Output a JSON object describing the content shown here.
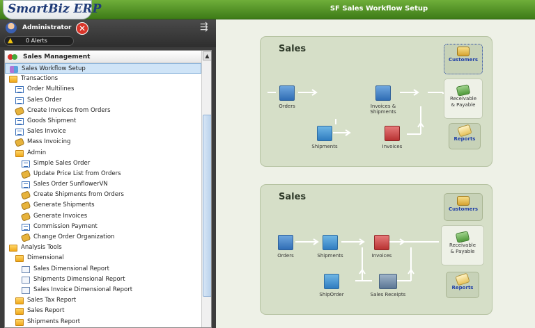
{
  "app": {
    "logo": "SmartBiz ERP",
    "page_title": "SF Sales Workflow Setup"
  },
  "user": {
    "name": "Administrator",
    "alerts": "0 Alerts",
    "logout_symbol": "✕",
    "pin_symbol": "⇶"
  },
  "menu": {
    "header": "Sales Management",
    "scroll_up": "▲",
    "items": [
      {
        "label": "Sales Workflow Setup",
        "icon": "workflow-icon",
        "indent": 1,
        "selected": true
      },
      {
        "label": "Transactions",
        "icon": "folder-icon",
        "indent": 1
      },
      {
        "label": "Order Multilines",
        "icon": "form-icon",
        "indent": 2
      },
      {
        "label": "Sales Order",
        "icon": "form-icon",
        "indent": 2
      },
      {
        "label": "Create Invoices from Orders",
        "icon": "process-icon",
        "indent": 2
      },
      {
        "label": "Goods Shipment",
        "icon": "form-icon",
        "indent": 2
      },
      {
        "label": "Sales Invoice",
        "icon": "form-icon",
        "indent": 2
      },
      {
        "label": "Mass Invoicing",
        "icon": "process-icon",
        "indent": 2
      },
      {
        "label": "Admin",
        "icon": "folder-icon",
        "indent": 2
      },
      {
        "label": "Simple Sales Order",
        "icon": "form-icon",
        "indent": 3
      },
      {
        "label": "Update Price List from Orders",
        "icon": "process-icon",
        "indent": 3
      },
      {
        "label": "Sales Order SunflowerVN",
        "icon": "form-icon",
        "indent": 3
      },
      {
        "label": "Create Shipments from Orders",
        "icon": "process-icon",
        "indent": 3
      },
      {
        "label": "Generate Shipments",
        "icon": "process-icon",
        "indent": 3
      },
      {
        "label": "Generate Invoices",
        "icon": "process-icon",
        "indent": 3
      },
      {
        "label": "Commission Payment",
        "icon": "form-icon",
        "indent": 3
      },
      {
        "label": "Change Order Organization",
        "icon": "process-icon",
        "indent": 3
      },
      {
        "label": "Analysis Tools",
        "icon": "folder-icon",
        "indent": 1
      },
      {
        "label": "Dimensional",
        "icon": "folder-icon",
        "indent": 2
      },
      {
        "label": "Sales Dimensional Report",
        "icon": "report-icon",
        "indent": 3
      },
      {
        "label": "Shipments Dimensional Report",
        "icon": "report-icon",
        "indent": 3
      },
      {
        "label": "Sales Invoice Dimensional Report",
        "icon": "report-icon",
        "indent": 3
      },
      {
        "label": "Sales Tax Report",
        "icon": "folder-icon",
        "indent": 2
      },
      {
        "label": "Sales Report",
        "icon": "folder-icon",
        "indent": 2
      },
      {
        "label": "Shipments Report",
        "icon": "folder-icon",
        "indent": 2
      }
    ]
  },
  "workflow1": {
    "title": "Sales",
    "nodes": {
      "orders": "Orders",
      "invoices_shipments": "Invoices & Shipments",
      "shipments": "Shipments",
      "invoices": "Invoices"
    },
    "customers": "Customers",
    "receivable_1": "Receivable",
    "receivable_2": "& Payable",
    "reports": "Reports"
  },
  "workflow2": {
    "title": "Sales",
    "nodes": {
      "orders": "Orders",
      "shipments": "Shipments",
      "invoices": "Invoices",
      "shiporder": "ShipOrder",
      "sales_receipts": "Sales Receipts"
    },
    "customers": "Customers",
    "receivable_1": "Receivable",
    "receivable_2": "& Payable",
    "reports": "Reports"
  }
}
